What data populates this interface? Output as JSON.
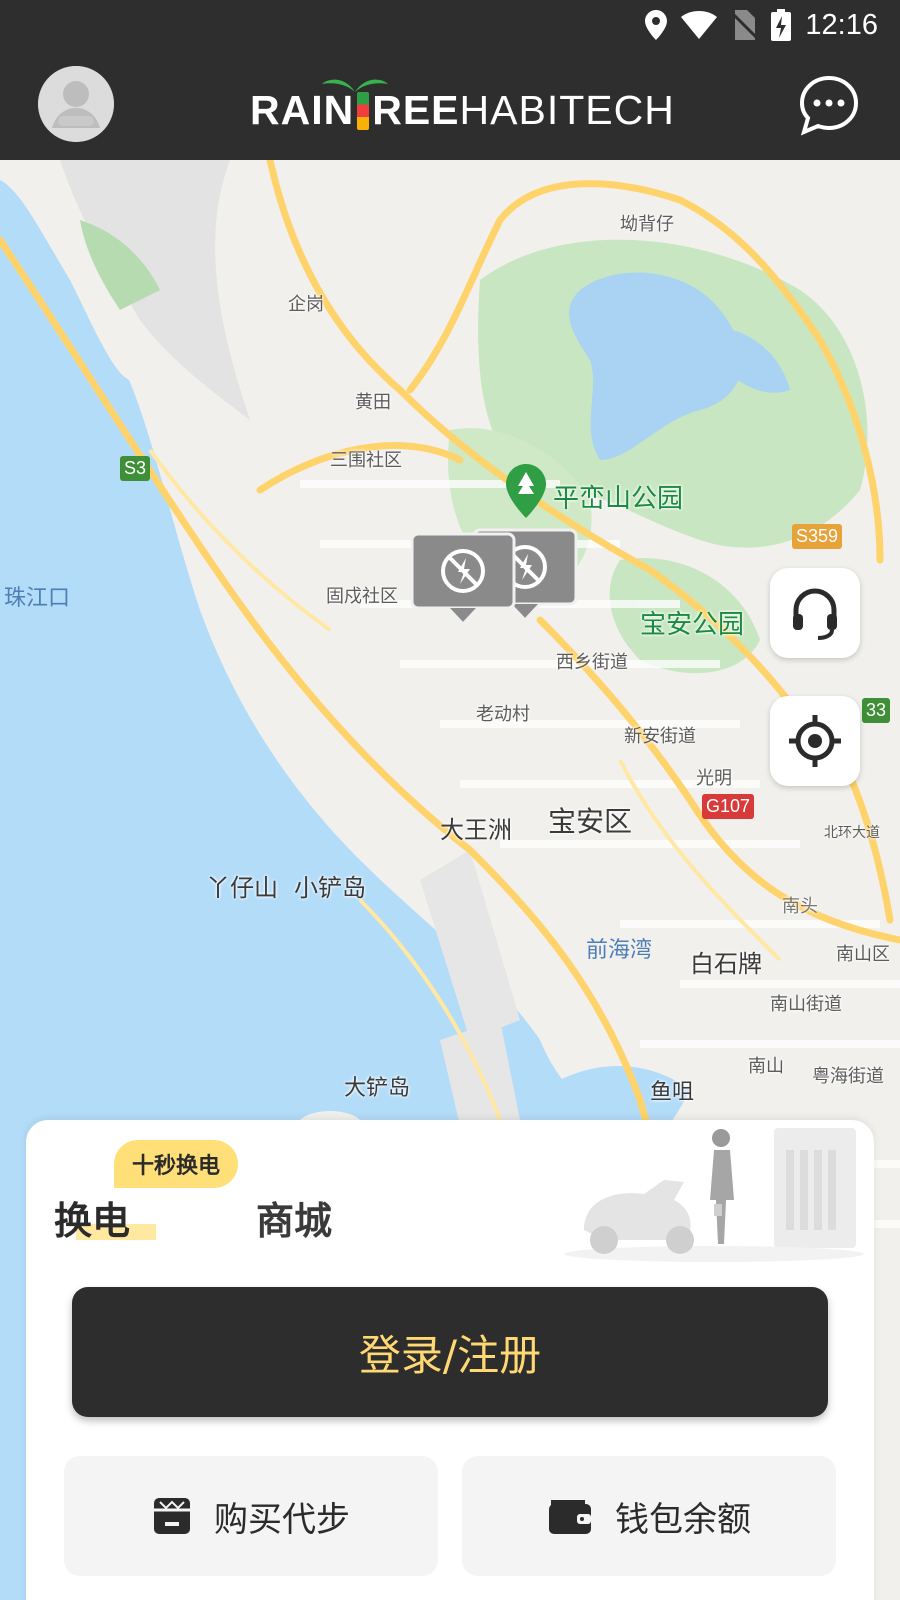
{
  "status_bar": {
    "time": "12:16",
    "icons": [
      "location-icon",
      "wifi-icon",
      "no-sim-icon",
      "battery-charging-icon"
    ]
  },
  "header": {
    "brand_part1": "RAIN",
    "brand_part2": "REE",
    "brand_part3": "HABITECH",
    "avatar_icon": "avatar-icon",
    "message_icon": "chat-bubble-icon"
  },
  "map": {
    "labels": {
      "aobeizai": "坳背仔",
      "qigang": "企岗",
      "huangtian": "黄田",
      "sanweishequ": "三围社区",
      "pingluanshan": "平峦山公园",
      "zhujiangkou": "珠江口",
      "guchengshequ": "固戍社区",
      "baoangongyuan": "宝安公园",
      "xixiangjiedao": "西乡街道",
      "laodongcun": "老动村",
      "xinanjiedao": "新安街道",
      "guangming": "光明",
      "dawangzhou": "大王洲",
      "baoanqu": "宝安区",
      "beihuandadao": "北环大道",
      "yazaishan": "丫仔山",
      "xiaochandao": "小铲岛",
      "nantou": "南头",
      "qianhaiwan": "前海湾",
      "baishipai": "白石牌",
      "nanshanqu": "南山区",
      "nanshanjiedao": "南山街道",
      "nanshan": "南山",
      "yuehaijiedao": "粤海街道",
      "dachandao": "大铲岛",
      "yuzui": "鱼咀"
    },
    "road_badges": {
      "s3": "S3",
      "s359": "S359",
      "s33": "33",
      "g107": "G107"
    },
    "colors": {
      "water": "#b3dcf9",
      "land": "#f1f0ed",
      "park": "#c8e6c1",
      "road": "#ffd36b"
    }
  },
  "side_buttons": {
    "support_icon": "headset-icon",
    "locate_icon": "crosshair-icon"
  },
  "sheet": {
    "promo_badge": "十秒换电",
    "tab_swap": "换电",
    "tab_mall": "商城",
    "login_button": "登录/注册",
    "buy_button": "购买代步",
    "wallet_button": "钱包余额",
    "accent_color": "#ffd873"
  }
}
